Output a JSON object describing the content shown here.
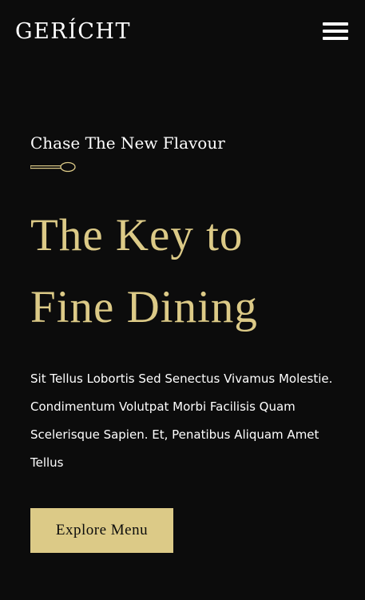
{
  "navbar": {
    "logo_text": "GERÍCHT",
    "menu_icon": "hamburger-menu-icon"
  },
  "hero": {
    "subtitle": "Chase The New Flavour",
    "spoon_icon": "spoon-icon",
    "title_line_1": "The Key to",
    "title_line_2": "Fine Dining",
    "description": "Sit Tellus Lobortis Sed Senectus Vivamus Molestie. Condimentum Volutpat Morbi Facilisis Quam Scelerisque Sapien. Et, Penatibus Aliquam Amet Tellus",
    "cta_label": "Explore Menu"
  },
  "colors": {
    "background": "#0c0c0c",
    "accent_gold": "#dcca87",
    "text": "#ffffff"
  }
}
